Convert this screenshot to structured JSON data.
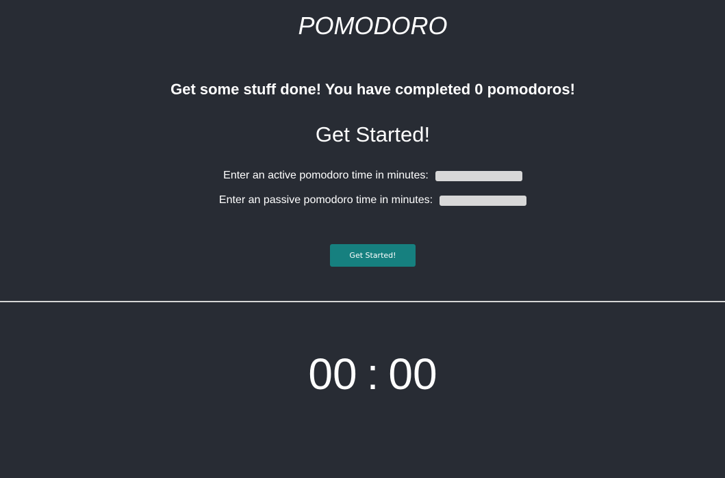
{
  "header": {
    "title": "POMODORO"
  },
  "status": {
    "message": "Get some stuff done! You have completed 0 pomodoros!"
  },
  "setup": {
    "heading": "Get Started!",
    "active_label": "Enter an active pomodoro time in minutes:",
    "active_value": "",
    "passive_label": "Enter an passive pomodoro time in minutes:",
    "passive_value": "",
    "button_label": "Get Started!"
  },
  "timer": {
    "minutes": "00",
    "separator": ":",
    "seconds": "00"
  },
  "colors": {
    "background": "#282c34",
    "accent": "#16807f",
    "input_fill": "#d8d8d8",
    "divider": "#d6d6d6"
  }
}
